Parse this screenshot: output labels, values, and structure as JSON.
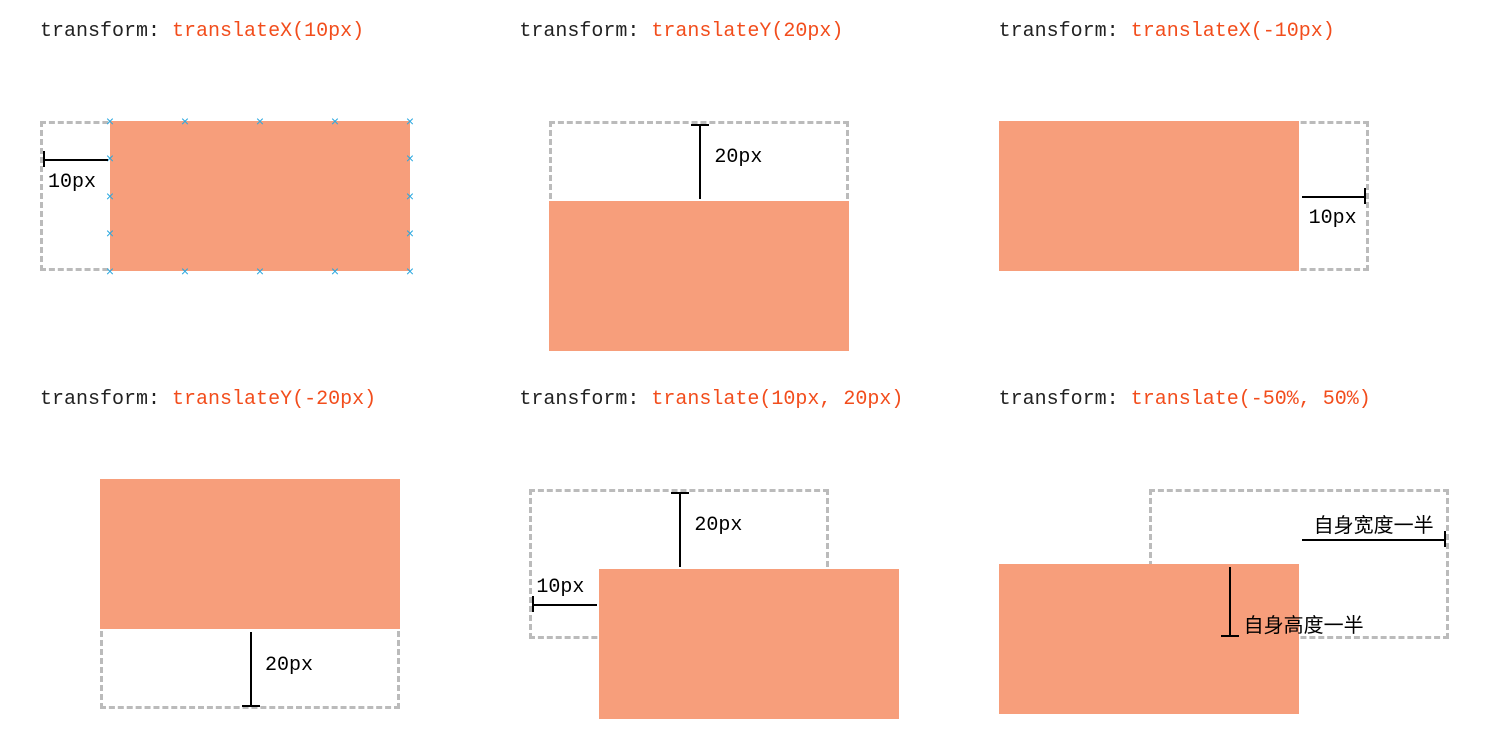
{
  "examples": [
    {
      "prop": "transform:",
      "val": "translateX(10px)",
      "dim1": "10px"
    },
    {
      "prop": "transform:",
      "val": "translateY(20px)",
      "dim1": "20px"
    },
    {
      "prop": "transform:",
      "val": "translateX(-10px)",
      "dim1": "10px"
    },
    {
      "prop": "transform:",
      "val": "translateY(-20px)",
      "dim1": "20px"
    },
    {
      "prop": "transform:",
      "val": "translate(10px, 20px)",
      "dim1": "20px",
      "dim2": "10px"
    },
    {
      "prop": "transform:",
      "val": "translate(-50%, 50%)",
      "dim1": "自身宽度一半",
      "dim2": "自身高度一半"
    }
  ]
}
